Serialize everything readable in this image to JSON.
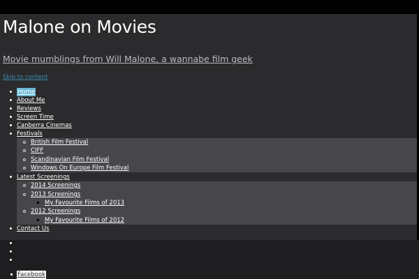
{
  "site": {
    "title": "Malone on Movies",
    "description": "Movie mumblings from Will Malone, a wannabe film geek",
    "skip_link": "Skip to content"
  },
  "nav": {
    "home": "Home",
    "about": "About Me",
    "reviews": "Reviews",
    "screen_time": "Screen Time",
    "canberra": "Canberra Cinemas",
    "festivals": "Festivals",
    "festivals_children": [
      "British Film Festival",
      "CIFF",
      "Scandinavian Film Festival",
      "Windows On Europe Film Festival"
    ],
    "latest": "Latest Screenings",
    "latest_children": {
      "s2014": "2014 Screenings",
      "s2013": "2013 Screenings",
      "fav2013": "My Favourite Films of 2013",
      "s2012": "2012 Screenings",
      "fav2012": "My Favourite Films of 2012"
    },
    "contact": "Contact Us"
  },
  "social": {
    "facebook": "Facebook"
  },
  "colors": {
    "page_bg": "#000000",
    "header_bg": "#2b2b2d",
    "submenu_bg": "#47474b",
    "footer_bg": "#1e1e20",
    "accent": "#67b6d3",
    "skip_link": "#3d8bb0"
  }
}
